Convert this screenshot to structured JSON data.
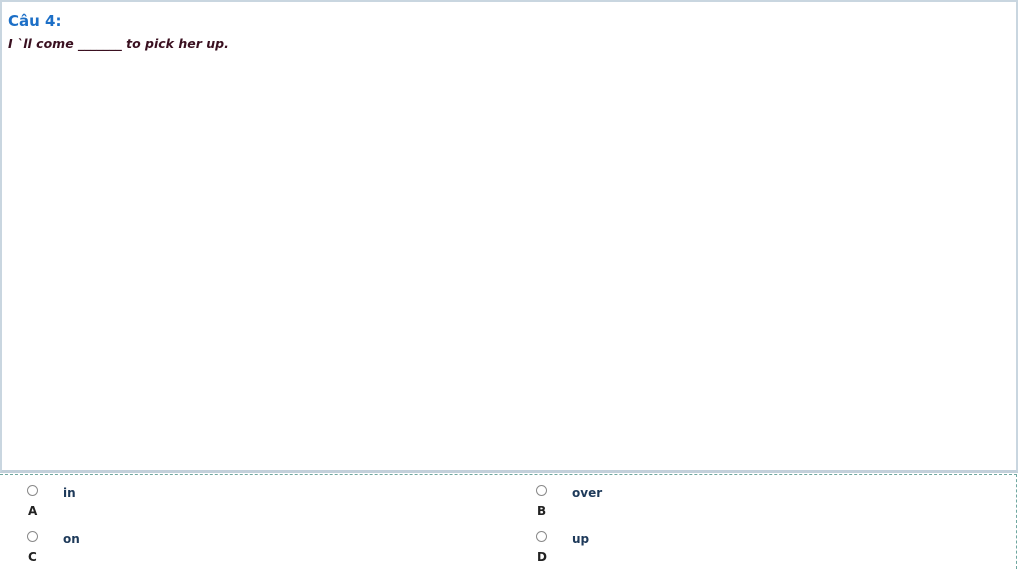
{
  "question": {
    "title": "Câu 4:",
    "text": "I `ll come _______ to pick her up."
  },
  "options": [
    {
      "letter": "A",
      "text": "in"
    },
    {
      "letter": "B",
      "text": "over"
    },
    {
      "letter": "C",
      "text": "on"
    },
    {
      "letter": "D",
      "text": "up"
    }
  ],
  "colors": {
    "title": "#1c6fc7",
    "question_text": "#3a1020",
    "answer_text": "#1e3a5a",
    "dashed_border": "#6fa7a0"
  }
}
